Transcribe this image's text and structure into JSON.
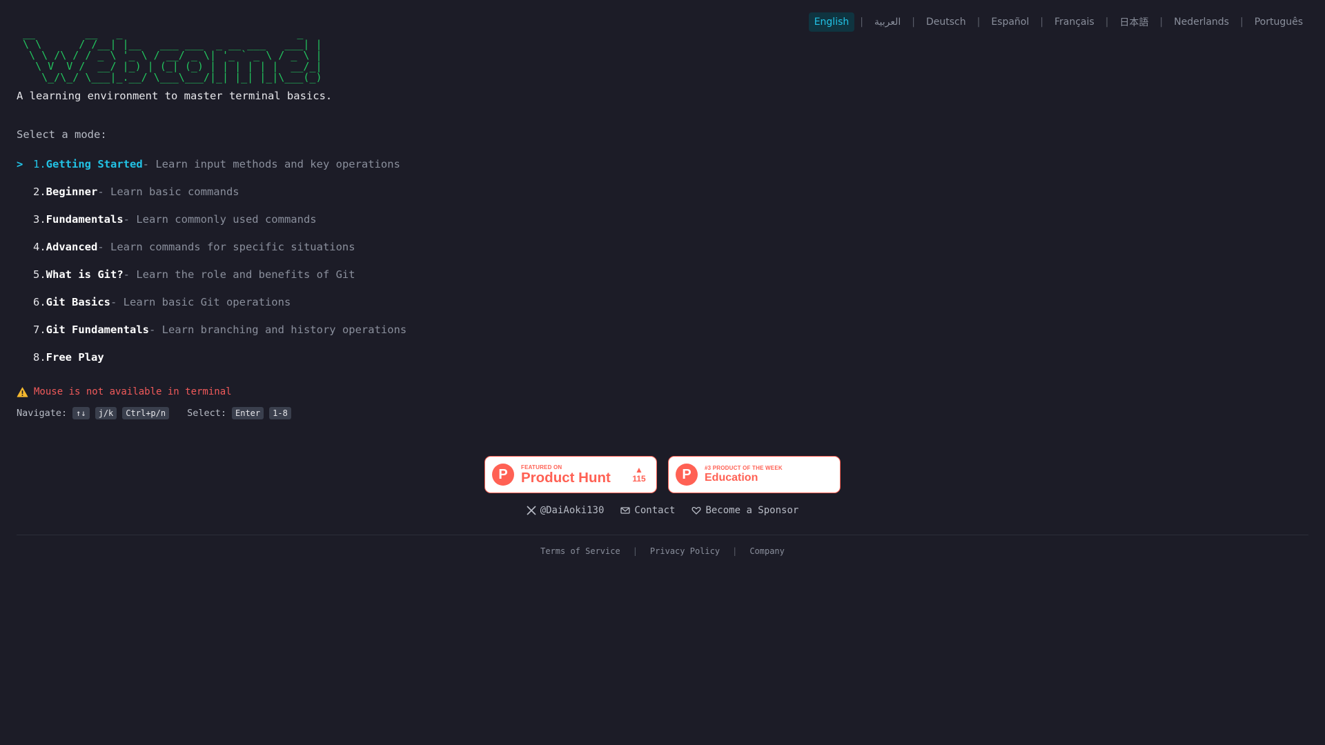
{
  "languages": {
    "items": [
      "English",
      "العربية",
      "Deutsch",
      "Español",
      "Français",
      "日本語",
      "Nederlands",
      "Português"
    ],
    "active": "English",
    "separator": "|"
  },
  "hero": {
    "ascii_art": " __        __   _                            _ \n \\ \\      / /__| |__   ___ ___  _ __ ___   ___| |\n  \\ \\ /\\ / / _ \\ '_ \\ / __/ _ \\| '_ ` _ \\ / _ \\ |\n   \\ V  V /  __/ |_) | (_| (_) | | | | | |  __/_|\n    \\_/\\_/ \\___|_.__/ \\___\\___/|_| |_| |_|\\___(_)",
    "tagline": "A learning environment to master terminal basics."
  },
  "menu": {
    "prompt": "Select a mode:",
    "cursor": ">",
    "items": [
      {
        "num": "1.",
        "title": "Getting Started",
        "desc": " - Learn input methods and key operations",
        "selected": true
      },
      {
        "num": "2.",
        "title": "Beginner",
        "desc": " - Learn basic commands"
      },
      {
        "num": "3.",
        "title": "Fundamentals",
        "desc": " - Learn commonly used commands"
      },
      {
        "num": "4.",
        "title": "Advanced",
        "desc": " - Learn commands for specific situations"
      },
      {
        "num": "5.",
        "title": "What is Git?",
        "desc": " - Learn the role and benefits of Git"
      },
      {
        "num": "6.",
        "title": "Git Basics",
        "desc": " - Learn basic Git operations"
      },
      {
        "num": "7.",
        "title": "Git Fundamentals",
        "desc": " - Learn branching and history operations"
      },
      {
        "num": "8.",
        "title": "Free Play",
        "desc": ""
      }
    ]
  },
  "warning": {
    "icon": "warning-icon",
    "text": "Mouse is not available in terminal"
  },
  "help": {
    "navigate_label": "Navigate:",
    "navigate_keys": [
      "↑↓",
      "j/k",
      "Ctrl+p/n"
    ],
    "select_label": "Select:",
    "select_keys": [
      "Enter",
      "1-8"
    ]
  },
  "badges": {
    "featured": {
      "small": "FEATURED ON",
      "big": "Product Hunt",
      "votes": "115",
      "logo": "P"
    },
    "weekly": {
      "small": "#3 PRODUCT OF THE WEEK",
      "big": "Education",
      "logo": "P"
    }
  },
  "social": {
    "x_handle": "@DaiAoki130",
    "contact": "Contact",
    "sponsor": "Become a Sponsor"
  },
  "footer": {
    "terms": "Terms of Service",
    "privacy": "Privacy Policy",
    "company": "Company",
    "separator": "|"
  },
  "colors": {
    "background": "#1c1c27",
    "accent": "#22c3e6",
    "ascii": "#22c55e",
    "warning": "#f05a5a",
    "producthunt": "#ff6154"
  }
}
